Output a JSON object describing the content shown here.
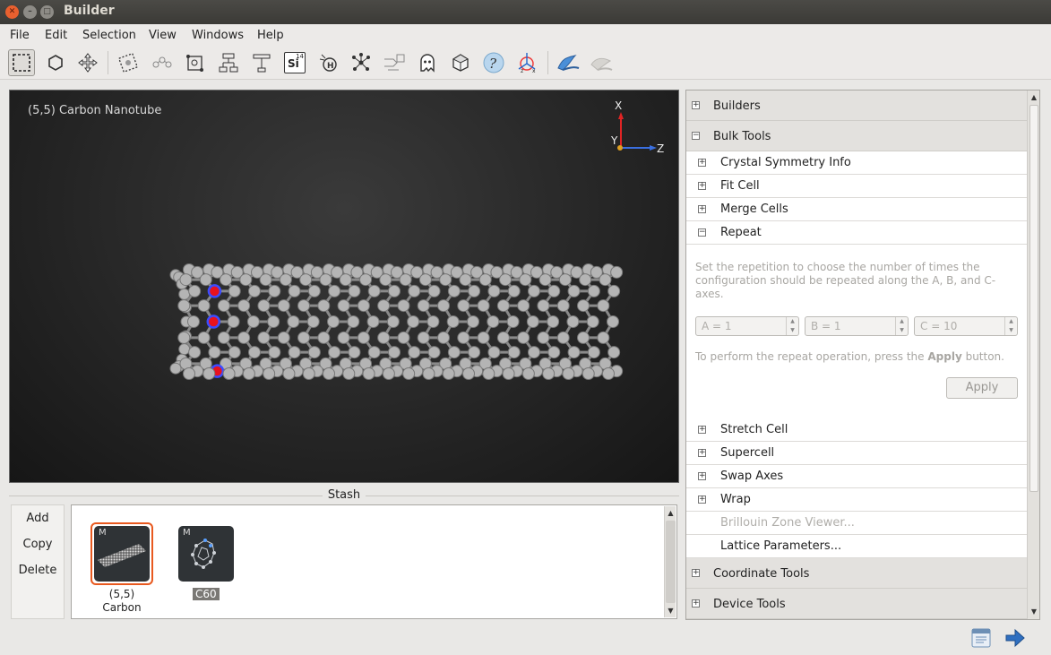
{
  "window": {
    "title": "Builder"
  },
  "menu": [
    {
      "label": "File"
    },
    {
      "label": "Edit"
    },
    {
      "label": "Selection"
    },
    {
      "label": "View"
    },
    {
      "label": "Windows"
    },
    {
      "label": "Help"
    }
  ],
  "toolbar": {
    "icons": [
      "select-rectangle-icon",
      "hexagon-icon",
      "move-icon",
      "selection-tag-icon",
      "atoms-chain-icon",
      "bounding-box-icon",
      "hierarchy-icon",
      "hierarchy-flat-icon",
      "element-si-icon",
      "hydrogen-add-icon",
      "molecule-network-icon",
      "export-arrow-icon",
      "ghost-icon",
      "cube-icon",
      "help-circle-icon",
      "axes-icon",
      "ribbon-icon",
      "ribbon-disabled-icon"
    ],
    "element_symbol": "Si",
    "element_number": "14"
  },
  "viewport": {
    "label": "(5,5) Carbon Nanotube",
    "axes": {
      "x": "X",
      "y": "Y",
      "z": "Z"
    }
  },
  "stash": {
    "title": "Stash",
    "buttons": {
      "add": "Add",
      "copy": "Copy",
      "delete": "Delete"
    },
    "items": [
      {
        "badge": "M",
        "caption_line1": "(5,5)",
        "caption_line2": "Carbon",
        "selected": true
      },
      {
        "badge": "M",
        "caption_line1": "C60",
        "selected": false
      }
    ]
  },
  "panel": {
    "sections": {
      "builders": "Builders",
      "bulk_tools": "Bulk Tools",
      "coordinate_tools": "Coordinate Tools",
      "device_tools": "Device Tools"
    },
    "bulk_items": {
      "crystal_symmetry": "Crystal Symmetry Info",
      "fit_cell": "Fit Cell",
      "merge_cells": "Merge Cells",
      "repeat": "Repeat",
      "stretch_cell": "Stretch Cell",
      "supercell": "Supercell",
      "swap_axes": "Swap Axes",
      "wrap": "Wrap",
      "brillouin": "Brillouin Zone Viewer...",
      "lattice": "Lattice Parameters..."
    },
    "repeat": {
      "description": "Set the repetition to choose the number of times the configuration should be repeated along the A, B, and C-axes.",
      "a": "A = 1",
      "b": "B = 1",
      "c": "C = 10",
      "hint_prefix": "To perform the repeat operation, press the ",
      "hint_bold": "Apply",
      "hint_suffix": " button.",
      "apply": "Apply"
    }
  },
  "colors": {
    "accent": "#e8591f",
    "carbon": "#b4b4b4",
    "selected_atom": "#e8121e",
    "highlight": "#3c4cff"
  }
}
